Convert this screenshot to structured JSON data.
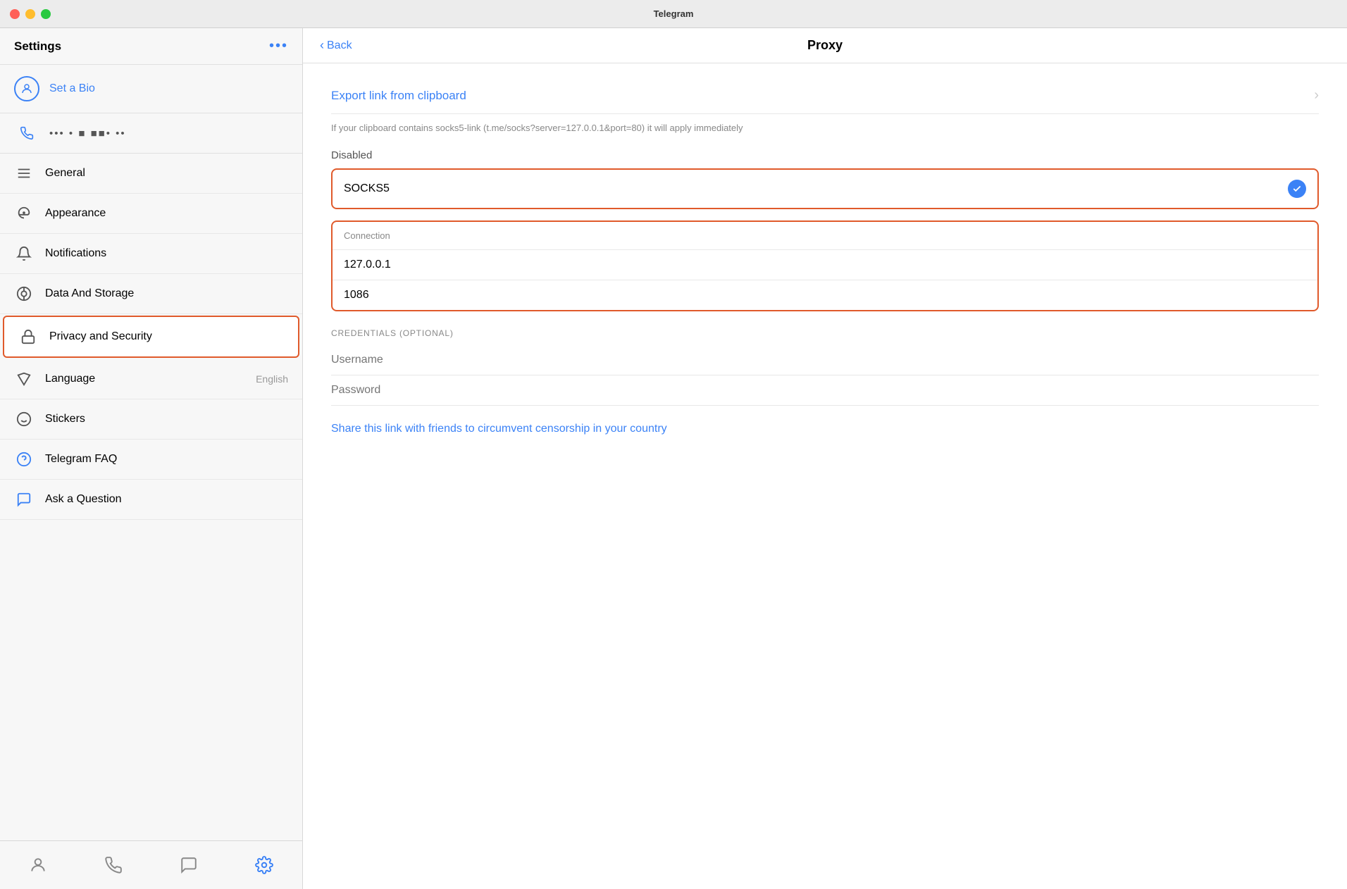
{
  "titlebar": {
    "title": "Telegram"
  },
  "sidebar": {
    "title": "Settings",
    "more_icon": "•••",
    "profile": {
      "bio_label": "Set a Bio"
    },
    "phone": {
      "number_masked": "•••  • ■ ■■• ••"
    },
    "nav_items": [
      {
        "id": "general",
        "label": "General",
        "icon": "general",
        "value": ""
      },
      {
        "id": "appearance",
        "label": "Appearance",
        "icon": "appearance",
        "value": ""
      },
      {
        "id": "notifications",
        "label": "Notifications",
        "icon": "notifications",
        "value": ""
      },
      {
        "id": "data-storage",
        "label": "Data And Storage",
        "icon": "data-storage",
        "value": ""
      },
      {
        "id": "privacy-security",
        "label": "Privacy and Security",
        "icon": "privacy-security",
        "value": "",
        "active": true
      },
      {
        "id": "language",
        "label": "Language",
        "icon": "language",
        "value": "English"
      },
      {
        "id": "stickers",
        "label": "Stickers",
        "icon": "stickers",
        "value": ""
      },
      {
        "id": "faq",
        "label": "Telegram FAQ",
        "icon": "faq",
        "value": ""
      },
      {
        "id": "ask-question",
        "label": "Ask a Question",
        "icon": "ask-question",
        "value": ""
      }
    ],
    "bottom_nav": [
      {
        "id": "contacts",
        "icon": "person"
      },
      {
        "id": "calls",
        "icon": "phone"
      },
      {
        "id": "chats",
        "icon": "chat"
      },
      {
        "id": "settings",
        "icon": "gear",
        "active": true
      }
    ]
  },
  "main": {
    "back_label": "Back",
    "page_title": "Proxy",
    "export_link": {
      "label": "Export link from clipboard",
      "description": "If your clipboard contains socks5-link (t.me/socks?server=127.0.0.1&port=80) it will apply immediately"
    },
    "disabled_label": "Disabled",
    "proxy_type": {
      "label": "SOCKS5",
      "selected": true
    },
    "connection": {
      "header": "Connection",
      "server": "127.0.0.1",
      "port": "1086"
    },
    "credentials": {
      "section_label": "CREDENTIALS (OPTIONAL)",
      "username_placeholder": "Username",
      "password_placeholder": "Password"
    },
    "share_link_label": "Share this link with friends to circumvent censorship in your country"
  }
}
